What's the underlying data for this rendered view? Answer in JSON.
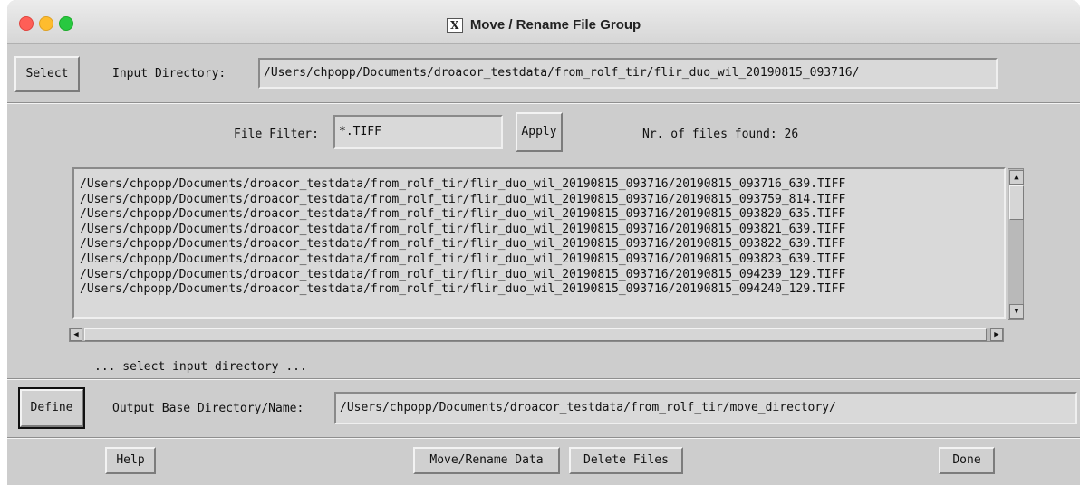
{
  "window": {
    "title": "Move / Rename File Group",
    "x_icon": "X"
  },
  "input": {
    "select_label": "Select",
    "dir_label": "Input Directory:",
    "dir_value": "/Users/chpopp/Documents/droacor_testdata/from_rolf_tir/flir_duo_wil_20190815_093716/"
  },
  "filter": {
    "label": "File Filter:",
    "value": "*.TIFF",
    "apply_label": "Apply",
    "count_text": "Nr. of files found: 26"
  },
  "files": [
    "/Users/chpopp/Documents/droacor_testdata/from_rolf_tir/flir_duo_wil_20190815_093716/20190815_093716_639.TIFF",
    "/Users/chpopp/Documents/droacor_testdata/from_rolf_tir/flir_duo_wil_20190815_093716/20190815_093759_814.TIFF",
    "/Users/chpopp/Documents/droacor_testdata/from_rolf_tir/flir_duo_wil_20190815_093716/20190815_093820_635.TIFF",
    "/Users/chpopp/Documents/droacor_testdata/from_rolf_tir/flir_duo_wil_20190815_093716/20190815_093821_639.TIFF",
    "/Users/chpopp/Documents/droacor_testdata/from_rolf_tir/flir_duo_wil_20190815_093716/20190815_093822_639.TIFF",
    "/Users/chpopp/Documents/droacor_testdata/from_rolf_tir/flir_duo_wil_20190815_093716/20190815_093823_639.TIFF",
    "/Users/chpopp/Documents/droacor_testdata/from_rolf_tir/flir_duo_wil_20190815_093716/20190815_094239_129.TIFF",
    "/Users/chpopp/Documents/droacor_testdata/from_rolf_tir/flir_duo_wil_20190815_093716/20190815_094240_129.TIFF"
  ],
  "status_text": "... select input directory ...",
  "output": {
    "define_label": "Define",
    "dir_label": "Output Base Directory/Name:",
    "dir_value": "/Users/chpopp/Documents/droacor_testdata/from_rolf_tir/move_directory/"
  },
  "bottom": {
    "help_label": "Help",
    "move_label": "Move/Rename Data",
    "delete_label": "Delete Files",
    "done_label": "Done"
  },
  "icons": {
    "scroll_up": "▲",
    "scroll_down": "▼",
    "scroll_left": "◀",
    "scroll_right": "▶"
  }
}
